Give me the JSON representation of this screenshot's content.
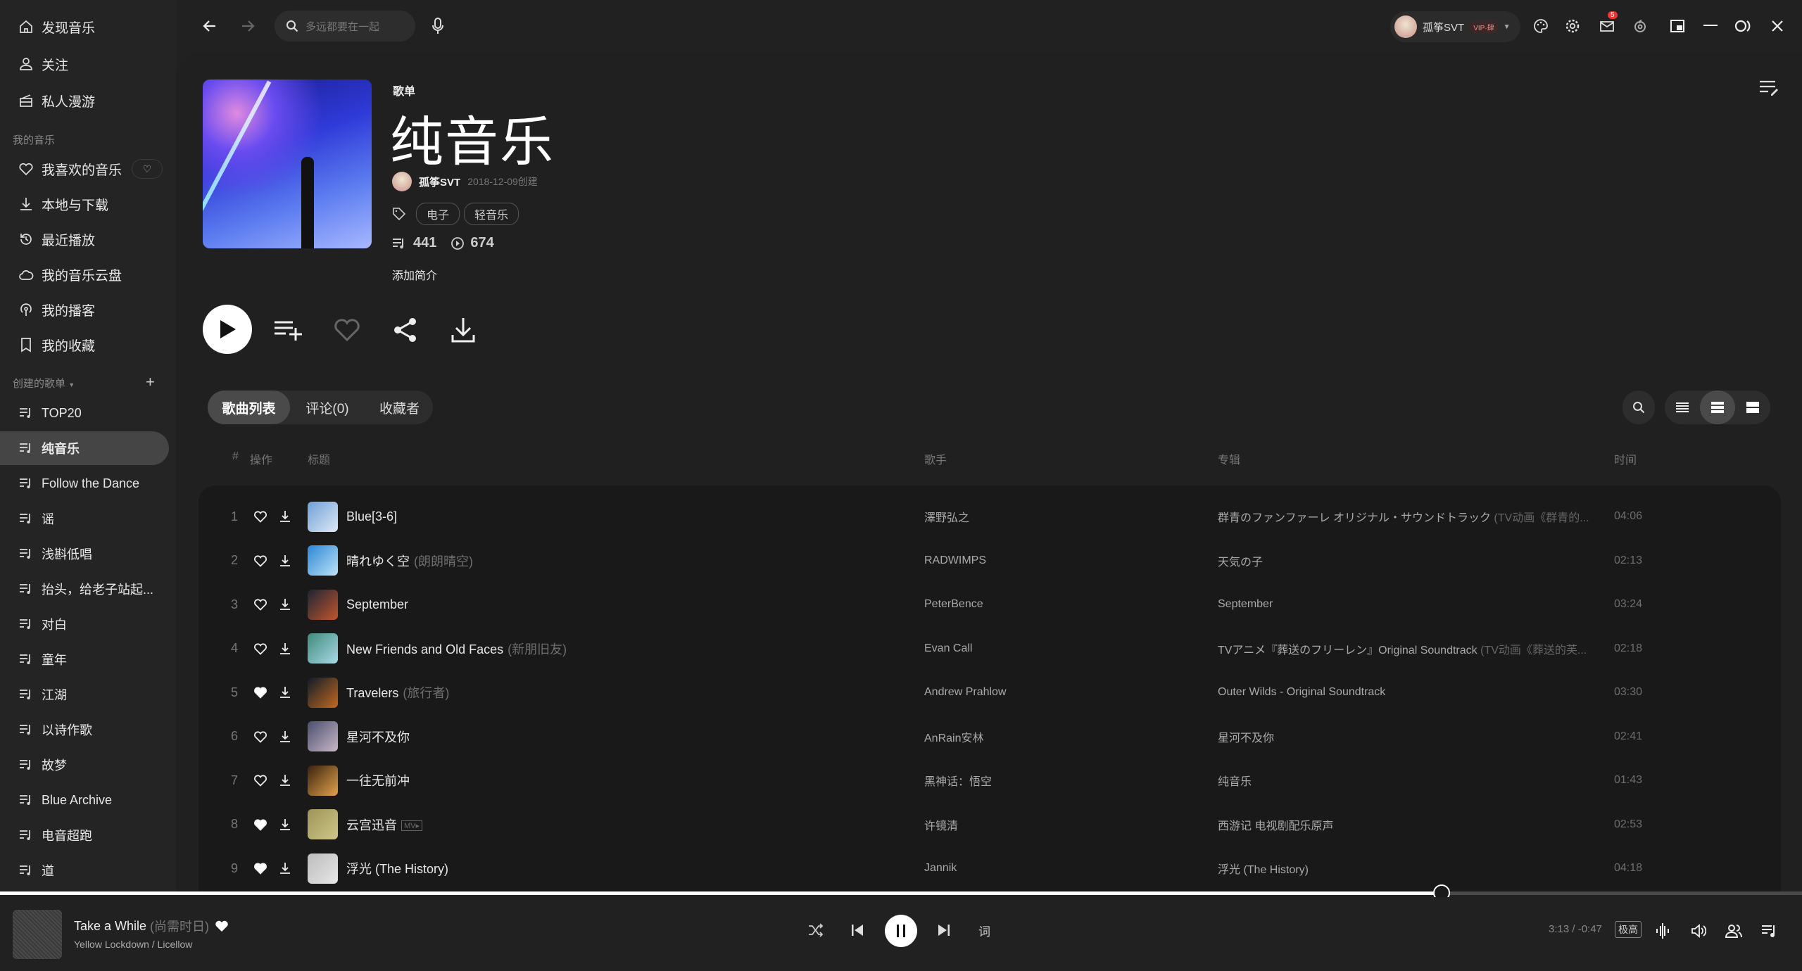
{
  "topbar": {
    "search_placeholder": "多远都要在一起",
    "user_name": "孤筝SVT",
    "vip_badge": "VIP·肆",
    "mail_count": "5"
  },
  "sidebar": {
    "nav": [
      {
        "label": "发现音乐",
        "icon": "home-icon"
      },
      {
        "label": "关注",
        "icon": "user-icon"
      },
      {
        "label": "私人漫游",
        "icon": "radio-icon"
      }
    ],
    "my_music_label": "我的音乐",
    "my_music": [
      {
        "label": "我喜欢的音乐",
        "icon": "heart-icon"
      },
      {
        "label": "本地与下载",
        "icon": "download-icon"
      },
      {
        "label": "最近播放",
        "icon": "history-icon"
      },
      {
        "label": "我的音乐云盘",
        "icon": "cloud-icon"
      },
      {
        "label": "我的播客",
        "icon": "podcast-icon"
      },
      {
        "label": "我的收藏",
        "icon": "bookmark-icon"
      }
    ],
    "created_label": "创建的歌单",
    "playlists": [
      "TOP20",
      "纯音乐",
      "Follow the Dance",
      "谣",
      "浅斟低唱",
      "抬头，给老子站起...",
      "对白",
      "童年",
      "江湖",
      "以诗作歌",
      "故梦",
      "Blue Archive",
      "电音超跑",
      "道"
    ],
    "active_playlist": 1
  },
  "playlist": {
    "type_label": "歌单",
    "title": "纯音乐",
    "creator": "孤筝SVT",
    "created": "2018-12-09创建",
    "tags": [
      "电子",
      "轻音乐"
    ],
    "song_count": "441",
    "play_count": "674",
    "add_intro": "添加简介"
  },
  "tabs": [
    {
      "label": "歌曲列表",
      "active": true
    },
    {
      "label": "评论(0)",
      "active": false
    },
    {
      "label": "收藏者",
      "active": false
    }
  ],
  "columns": {
    "num": "#",
    "ops": "操作",
    "title": "标题",
    "artist": "歌手",
    "album": "专辑",
    "duration": "时间"
  },
  "songs": [
    {
      "n": "1",
      "title": "Blue[3-6]",
      "alias": "",
      "liked": false,
      "mv": false,
      "artist": "澤野弘之",
      "album": "群青のファンファーレ オリジナル・サウンドトラック",
      "album_note": "(TV动画《群青的...",
      "duration": "04:06",
      "thumb": [
        "#6f9fd8",
        "#dfe9f5"
      ]
    },
    {
      "n": "2",
      "title": "晴れゆく空",
      "alias": "(朗朗晴空)",
      "liked": false,
      "mv": false,
      "artist": "RADWIMPS",
      "album": "天気の子",
      "album_note": "",
      "duration": "02:13",
      "thumb": [
        "#2b86d6",
        "#bde3f7"
      ]
    },
    {
      "n": "3",
      "title": "September",
      "alias": "",
      "liked": false,
      "mv": false,
      "artist": "PeterBence",
      "album": "September",
      "album_note": "",
      "duration": "03:24",
      "thumb": [
        "#1c2436",
        "#c2552b"
      ]
    },
    {
      "n": "4",
      "title": "New Friends and Old Faces",
      "alias": "(新朋旧友)",
      "liked": false,
      "mv": false,
      "artist": "Evan Call",
      "album": "TVアニメ『葬送のフリーレン』Original Soundtrack",
      "album_note": "(TV动画《葬送的芙...",
      "duration": "02:18",
      "thumb": [
        "#3f8a7a",
        "#a9d9e8"
      ]
    },
    {
      "n": "5",
      "title": "Travelers",
      "alias": "(旅行者)",
      "liked": true,
      "mv": false,
      "artist": "Andrew Prahlow",
      "album": "Outer Wilds - Original Soundtrack",
      "album_note": "",
      "duration": "03:30",
      "thumb": [
        "#0f1a2a",
        "#c26a1e"
      ]
    },
    {
      "n": "6",
      "title": "星河不及你",
      "alias": "",
      "liked": false,
      "mv": false,
      "artist": "AnRain安林",
      "album": "星河不及你",
      "album_note": "",
      "duration": "02:41",
      "thumb": [
        "#4a4e6e",
        "#c9b8c6"
      ]
    },
    {
      "n": "7",
      "title": "一往无前冲",
      "alias": "",
      "liked": false,
      "mv": false,
      "artist": "黑神话：悟空",
      "album": "纯音乐",
      "album_note": "",
      "duration": "01:43",
      "thumb": [
        "#3a220e",
        "#e3a24b"
      ]
    },
    {
      "n": "8",
      "title": "云宫迅音",
      "alias": "",
      "liked": true,
      "mv": true,
      "mv_label": "MV▸",
      "artist": "许镜清",
      "album": "西游记 电视剧配乐原声",
      "album_note": "",
      "duration": "02:53",
      "thumb": [
        "#9e9458",
        "#cfc68a"
      ]
    },
    {
      "n": "9",
      "title": "浮光 (The History)",
      "alias": "",
      "liked": true,
      "mv": false,
      "artist": "Jannik",
      "album": "浮光 (The History)",
      "album_note": "",
      "duration": "04:18",
      "thumb": [
        "#bdbdbd",
        "#e6e6e6"
      ]
    }
  ],
  "player": {
    "title": "Take a While",
    "alias": "(尚需时日)",
    "artist": "Yellow Lockdown / Licellow",
    "time": "3:13 / -0:47",
    "quality": "极高",
    "lyrics_label": "词",
    "progress": 0.8
  }
}
